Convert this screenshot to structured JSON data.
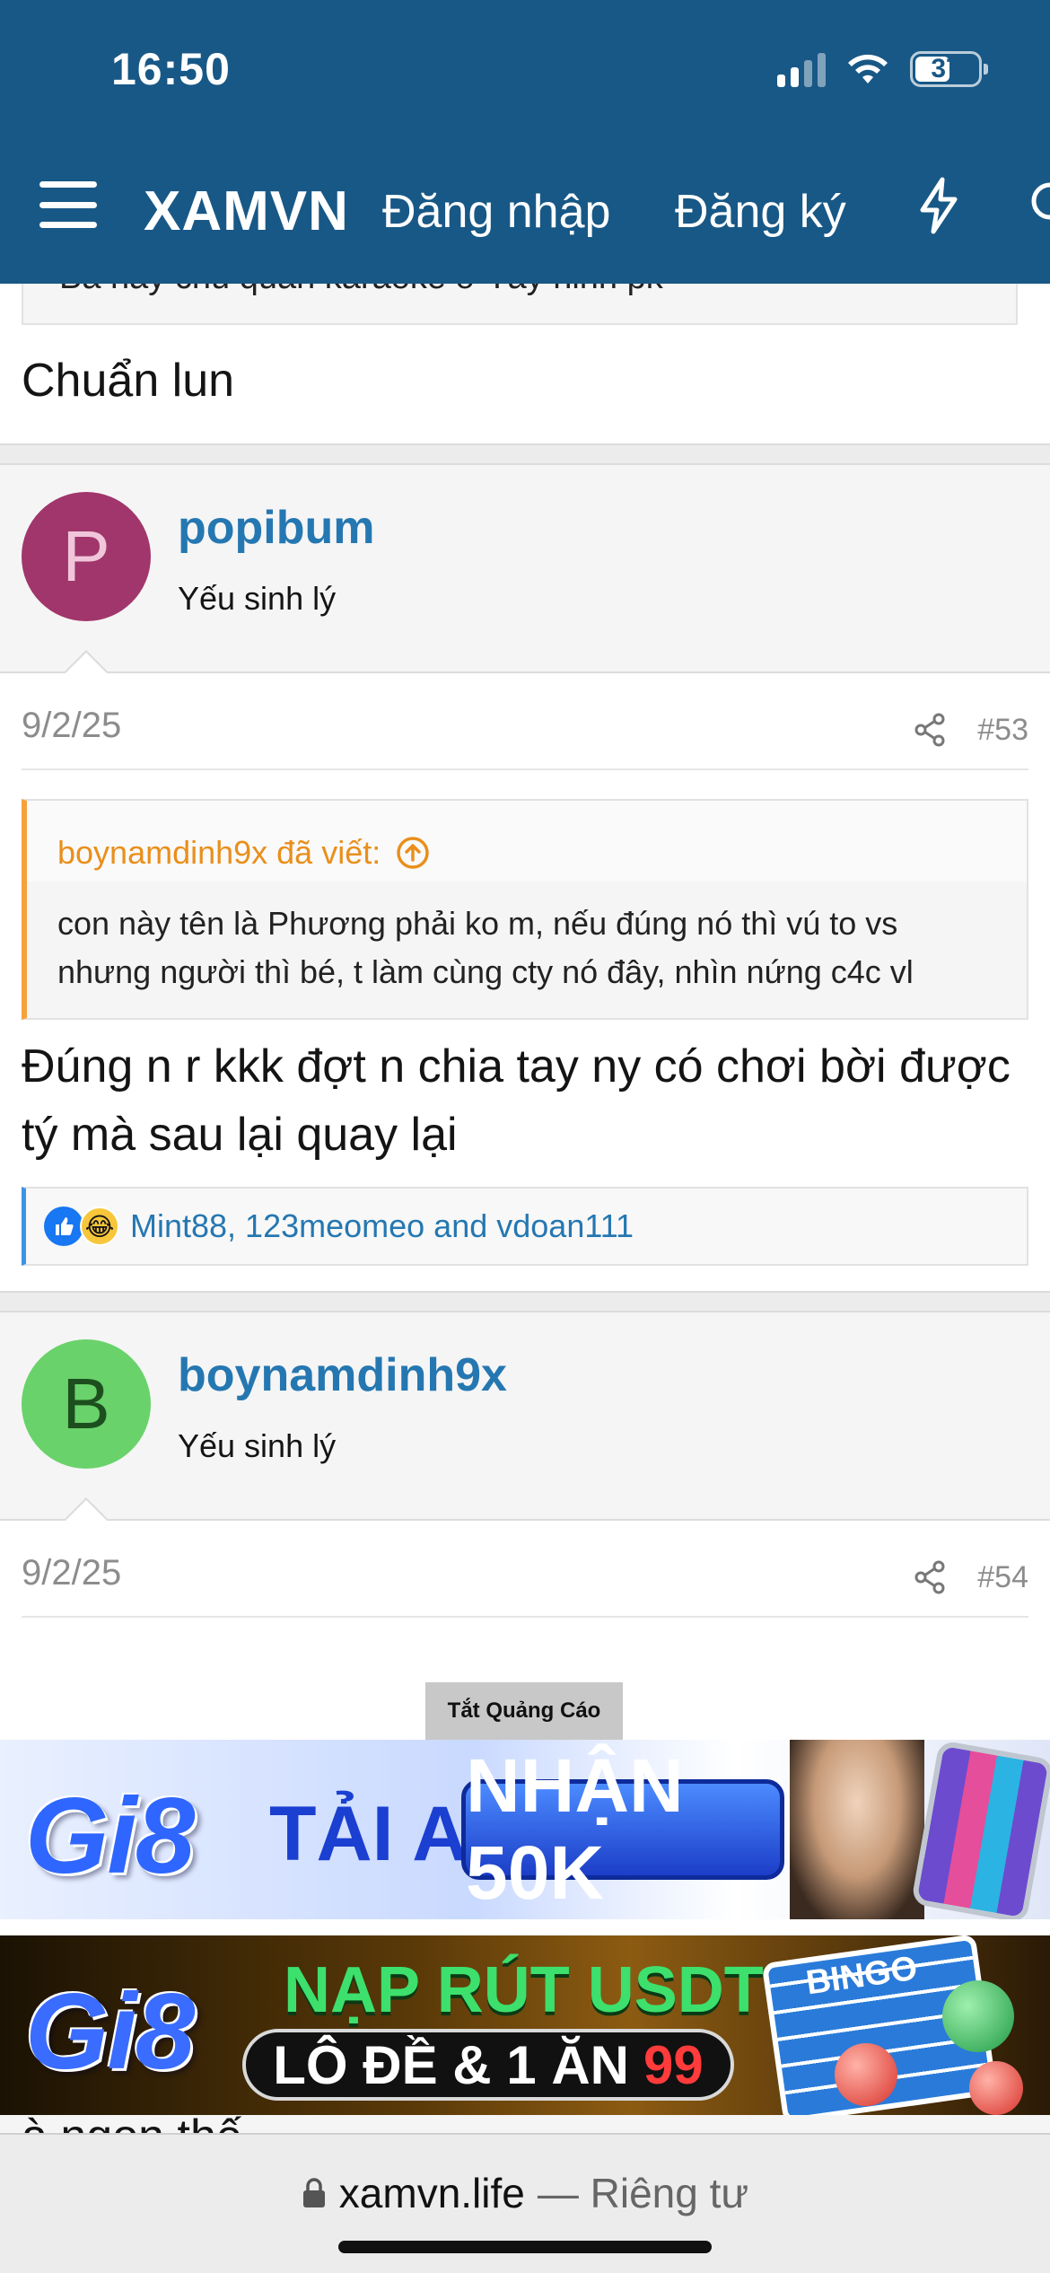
{
  "status": {
    "time": "16:50",
    "battery": "37"
  },
  "header": {
    "logo": "XAMVN",
    "login": "Đăng nhập",
    "register": "Đăng ký",
    "brand_color": "#185886"
  },
  "prev_post": {
    "quote_tail": "Ba hay chủ quán karaoke ở Tây ninh pk",
    "body": "Chuẩn lun"
  },
  "posts": [
    {
      "avatar_letter": "P",
      "avatar_color": "#a0366b",
      "username": "popibum",
      "user_title": "Yếu sinh lý",
      "date": "9/2/25",
      "number": "#53",
      "quote_author": "boynamdinh9x đã viết:",
      "quote_text": "con này tên là Phương phải ko m, nếu đúng nó thì vú to vs nhưng người thì bé, t làm cùng cty nó đây, nhìn nứng c4c vl",
      "body": "Đúng n r kkk đợt n chia tay ny có chơi bời được tý mà sau lại quay lại",
      "reactions": "Mint88, 123meomeo and vdoan111"
    },
    {
      "avatar_letter": "B",
      "avatar_color": "#69d26a",
      "username": "boynamdinh9x",
      "user_title": "Yếu sinh lý",
      "date": "9/2/25",
      "number": "#54"
    }
  ],
  "ads": {
    "label": "Tắt Quảng Cáo",
    "ad1": {
      "brand": "Gi8",
      "title": "TẢI APP",
      "pill": "NHẬN 50K"
    },
    "ad2": {
      "brand": "Gi8",
      "top": "NẠP RÚT USDT",
      "bar_left": "LÔ ĐỀ & 1 ĂN",
      "bar_num": "99",
      "bingo": "BINGO"
    }
  },
  "bottom_partial_text": "à ngon thế",
  "browser": {
    "domain": "xamvn.life",
    "privacy": "— Riêng tư"
  }
}
